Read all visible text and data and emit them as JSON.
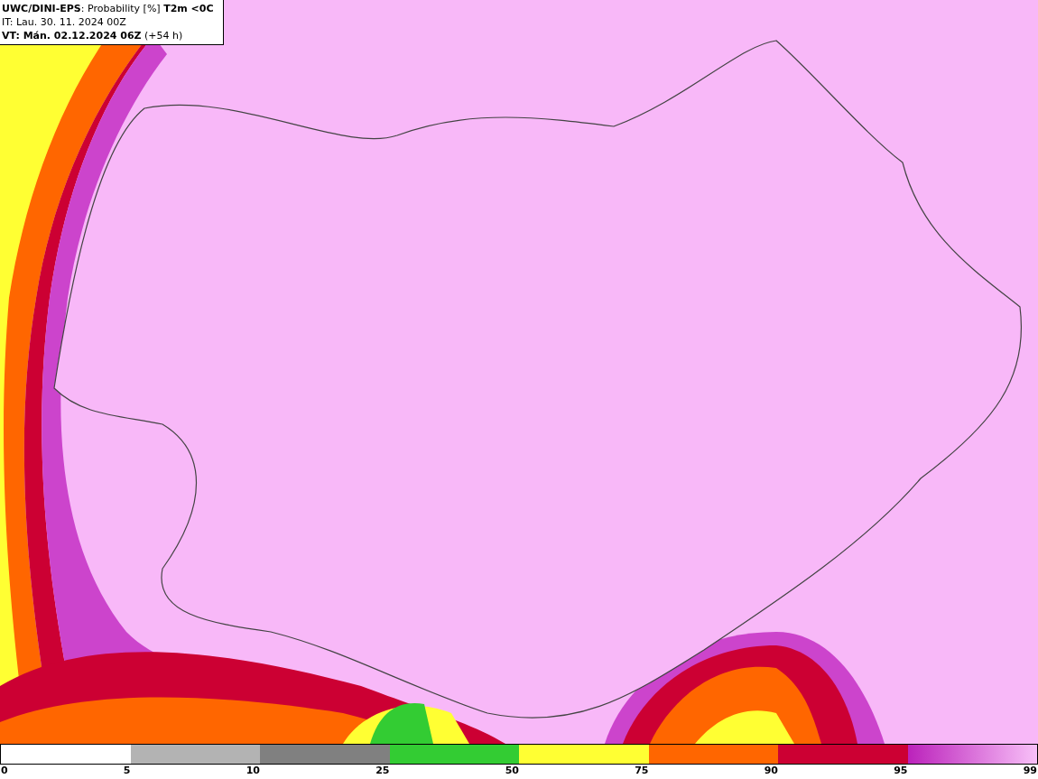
{
  "header": {
    "lines": [
      "**UWC/DINI-EPS**: Probability [%] **T2m <0C**",
      "IT: Lau. 30. 11. 2024 00Z",
      "**VT: Mán. 02.12.2024 06Z** (+54 h)"
    ]
  },
  "legend": {
    "segments": [
      {
        "kind": "empty"
      },
      {
        "kind": "solid",
        "color": "#b3b3b3"
      },
      {
        "kind": "solid",
        "color": "#808080"
      },
      {
        "kind": "solid",
        "color": "#33cc33"
      },
      {
        "kind": "solid",
        "color": "#ffff33"
      },
      {
        "kind": "solid",
        "color": "#ff6600"
      },
      {
        "kind": "solid",
        "color": "#cc0033"
      },
      {
        "kind": "gradient"
      }
    ],
    "labels": [
      "0",
      "5",
      "10",
      "25",
      "50",
      "75",
      "90",
      "95",
      "99"
    ]
  }
}
